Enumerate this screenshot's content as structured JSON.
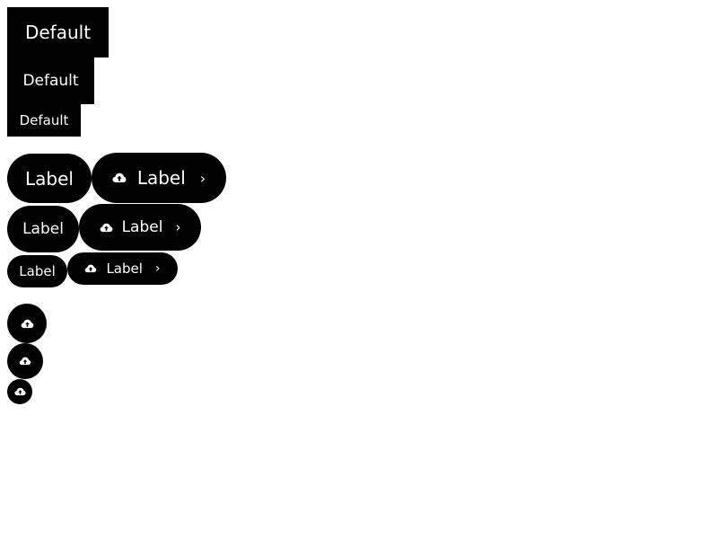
{
  "square_buttons": {
    "large": "Default",
    "medium": "Default",
    "small": "Default"
  },
  "pill_buttons": {
    "large_label": "Label",
    "large_icon_label": "Label",
    "large_chevron": "›",
    "medium_label": "Label",
    "medium_icon_label": "Label",
    "medium_chevron": "›",
    "small_label": "Label",
    "small_icon_label": "Label",
    "small_chevron": "›"
  },
  "icons": {
    "upload": "cloud-upload-icon",
    "chevron": "chevron-right-icon"
  },
  "colors": {
    "button_background": "#000000",
    "button_text": "#ffffff",
    "page_background": "#ffffff"
  }
}
